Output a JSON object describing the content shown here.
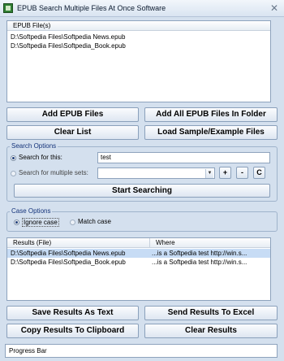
{
  "window": {
    "title": "EPUB Search Multiple Files At Once Software",
    "close_glyph": "✕",
    "icon": "app-icon"
  },
  "files": {
    "header": "EPUB File(s)",
    "items": [
      "D:\\Softpedia Files\\Softpedia News.epub",
      "D:\\Softpedia Files\\Softpedia_Book.epub"
    ]
  },
  "buttons": {
    "add_epub_files": "Add EPUB Files",
    "add_all_in_folder": "Add All EPUB Files In Folder",
    "clear_list": "Clear List",
    "load_sample": "Load Sample/Example Files",
    "start_searching": "Start Searching",
    "save_results_text": "Save Results As Text",
    "send_results_excel": "Send Results To Excel",
    "copy_results_clipboard": "Copy Results To Clipboard",
    "clear_results": "Clear Results",
    "plus": "+",
    "minus": "-",
    "clear_c": "C"
  },
  "search_options": {
    "legend": "Search Options",
    "search_for_this_label": "Search for this:",
    "search_for_this_value": "test",
    "search_multiple_label": "Search for multiple sets:",
    "search_multiple_value": "",
    "selected": "search_for_this"
  },
  "case_options": {
    "legend": "Case Options",
    "ignore_case_label": "Ignore case",
    "match_case_label": "Match case",
    "selected": "ignore_case"
  },
  "results": {
    "columns": [
      "Results (File)",
      "Where"
    ],
    "rows": [
      {
        "file": "D:\\Softpedia Files\\Softpedia News.epub",
        "where": "...is a Softpedia test http://win.s..."
      },
      {
        "file": "D:\\Softpedia Files\\Softpedia_Book.epub",
        "where": "...is a Softpedia test http://win.s..."
      }
    ]
  },
  "status": {
    "progress_label": "Progress Bar"
  }
}
